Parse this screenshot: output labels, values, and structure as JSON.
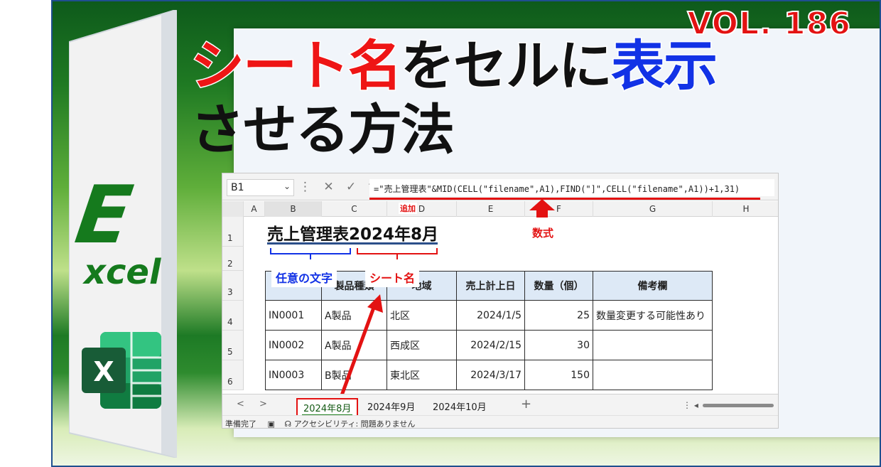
{
  "vol_label": "VOL. 186",
  "logo": {
    "letter_e": "E",
    "letter_xcel": "xcel",
    "icon_letter": "X"
  },
  "title": {
    "line1": [
      {
        "text": "シート名",
        "color": "red"
      },
      {
        "text": "をセルに",
        "color": "black"
      },
      {
        "text": "表示",
        "color": "blue"
      }
    ],
    "line2": "させる方法"
  },
  "excel": {
    "name_box": "B1",
    "formula_icons": "⋮ ✕ ✓ fx",
    "formula": "=\"売上管理表\"&MID(CELL(\"filename\",A1),FIND(\"]\",CELL(\"filename\",A1))+1,31)",
    "columns": [
      "A",
      "B",
      "C",
      "D",
      "E",
      "F",
      "G",
      "H"
    ],
    "rows": [
      "1",
      "2",
      "3",
      "4",
      "5",
      "6"
    ],
    "b1_value": "売上管理表2024年8月",
    "table_headers": [
      "",
      "製品種類",
      "地域",
      "売上計上日",
      "数量（個）",
      "備考欄"
    ],
    "table_rows": [
      [
        "IN0001",
        "A製品",
        "北区",
        "2024/1/5",
        "25",
        "数量変更する可能性あり"
      ],
      [
        "IN0002",
        "A製品",
        "西成区",
        "2024/2/15",
        "30",
        ""
      ],
      [
        "IN0003",
        "B製品",
        "東北区",
        "2024/3/17",
        "150",
        ""
      ]
    ],
    "sheet_tabs": [
      "2024年8月",
      "2024年9月",
      "2024年10月"
    ],
    "nav_prev": "<",
    "nav_next": ">",
    "add_tab": "+",
    "status_ready": "準備完了",
    "status_accessibility": "アクセシビリティ: 問題ありません",
    "hscroll_icon": "⋮  ◂"
  },
  "annotations": {
    "arbitrary_text": "任意の文字",
    "sheet_name": "シート名",
    "added": "追加",
    "formula": "数式"
  },
  "colors": {
    "red": "#e31212",
    "blue": "#1232e6",
    "excel_green": "#157a1d",
    "header_fill": "#dde9f6"
  }
}
